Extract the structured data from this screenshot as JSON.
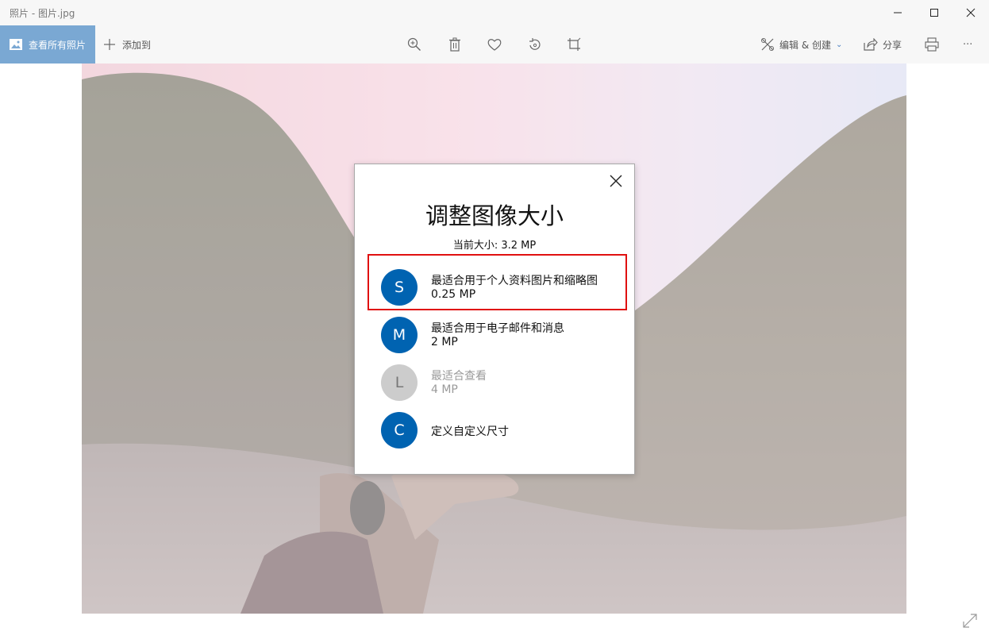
{
  "window": {
    "title": "照片 - 图片.jpg"
  },
  "toolbar": {
    "view_all_label": "查看所有照片",
    "add_to_label": "添加到",
    "edit_create_label": "编辑 & 创建",
    "share_label": "分享",
    "more_label": "···"
  },
  "dialog": {
    "title": "调整图像大小",
    "current_size": "当前大小: 3.2 MP",
    "options": [
      {
        "letter": "S",
        "label": "最适合用于个人资料图片和缩略图",
        "size": "0.25 MP",
        "enabled": true,
        "highlighted": true
      },
      {
        "letter": "M",
        "label": "最适合用于电子邮件和消息",
        "size": "2 MP",
        "enabled": true,
        "highlighted": false
      },
      {
        "letter": "L",
        "label": "最适合查看",
        "size": "4 MP",
        "enabled": false,
        "highlighted": false
      },
      {
        "letter": "C",
        "label": "定义自定义尺寸",
        "size": "",
        "enabled": true,
        "highlighted": false
      }
    ]
  },
  "colors": {
    "accent": "#0063b1",
    "view_all_bg": "#7aa8d3",
    "highlight_border": "#e01010"
  }
}
